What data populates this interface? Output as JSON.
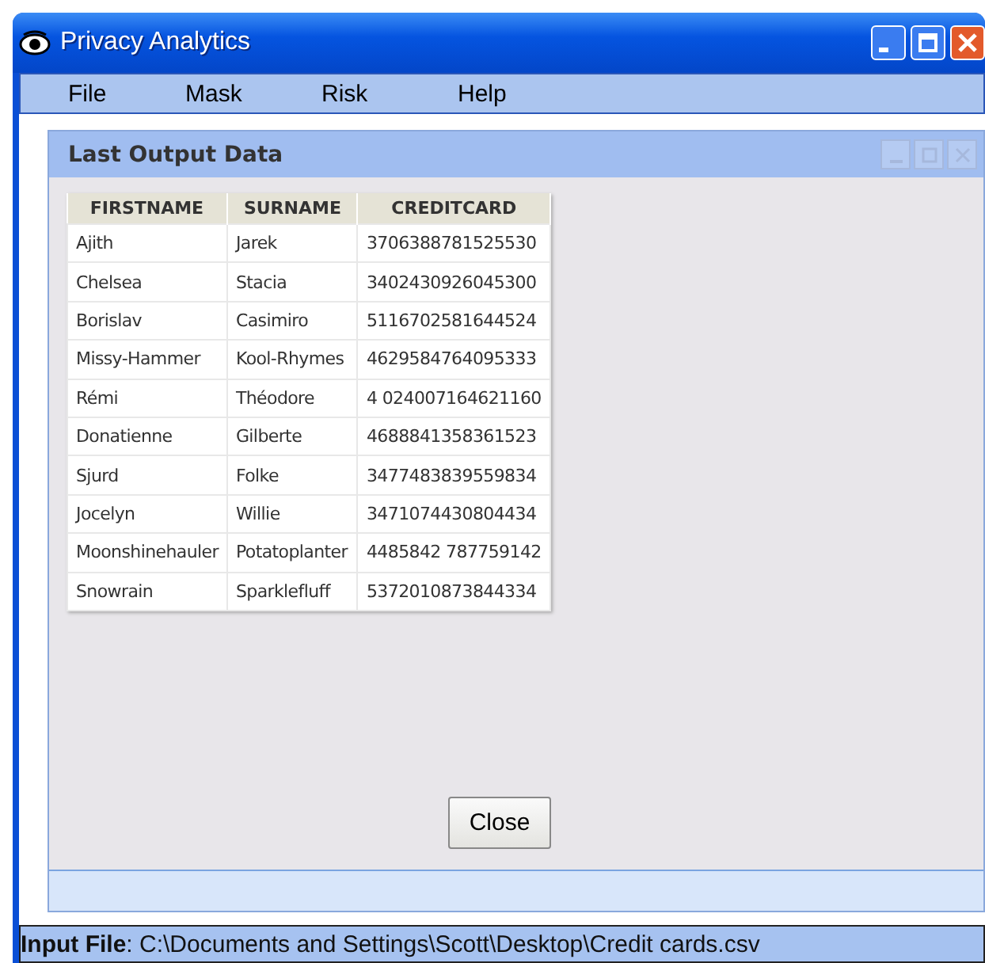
{
  "window": {
    "title": "Privacy Analytics"
  },
  "menu": [
    "File",
    "Mask",
    "Risk",
    "Help"
  ],
  "frame": {
    "title": "Last Output Data"
  },
  "table": {
    "columns": [
      "FIRSTNAME",
      "SURNAME",
      "CREDITCARD"
    ],
    "rows": [
      [
        "Ajith",
        "Jarek",
        "3706388781525530"
      ],
      [
        "Chelsea",
        "Stacia",
        "3402430926045300"
      ],
      [
        "Borislav",
        "Casimiro",
        "5116702581644524"
      ],
      [
        "Missy-Hammer",
        "Kool-Rhymes",
        "4629584764095333"
      ],
      [
        "Rémi",
        "Théodore",
        "4 024007164621160"
      ],
      [
        "Donatienne",
        "Gilberte",
        "4688841358361523"
      ],
      [
        "Sjurd",
        "Folke",
        "3477483839559834"
      ],
      [
        "Jocelyn",
        "Willie",
        "3471074430804434"
      ],
      [
        "Moonshinehauler",
        "Potatoplanter",
        "4485842 787759142"
      ],
      [
        "Snowrain",
        "Sparklefluff",
        "5372010873844334"
      ]
    ]
  },
  "close_button": "Close",
  "status_bar": "**Input File**: C:\\Documents and Settings\\Scott\\Desktop\\Credit cards.csv"
}
